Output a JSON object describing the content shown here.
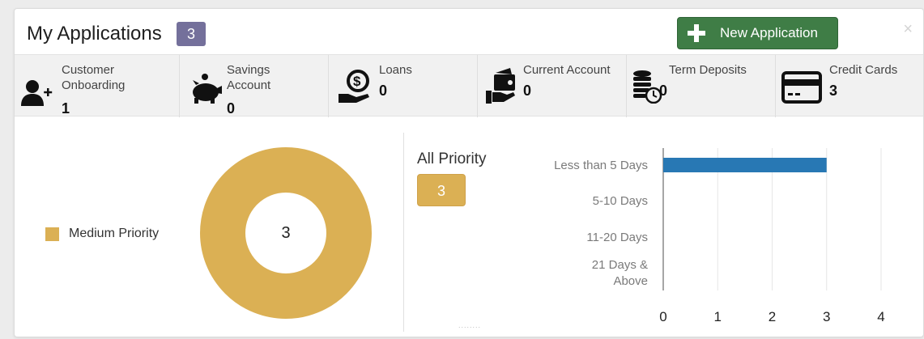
{
  "header": {
    "title": "My Applications",
    "count": "3",
    "new_application_label": "New Application",
    "close_symbol": "×"
  },
  "categories": [
    {
      "label_line1": "Customer",
      "label_line2": "Onboarding",
      "value": "1",
      "icon": "add-user-icon"
    },
    {
      "label_line1": "Savings",
      "label_line2": "Account",
      "value": "0",
      "icon": "piggy-bank-icon"
    },
    {
      "label_line1": "Loans",
      "label_line2": "",
      "value": "0",
      "icon": "loan-hand-coin-icon"
    },
    {
      "label_line1": "Current Account",
      "label_line2": "",
      "value": "0",
      "icon": "wallet-hand-icon"
    },
    {
      "label_line1": "Term Deposits",
      "label_line2": "",
      "value": "0",
      "icon": "coins-clock-icon"
    },
    {
      "label_line1": "Credit Cards",
      "label_line2": "",
      "value": "3",
      "icon": "credit-card-icon"
    }
  ],
  "donut": {
    "legend": "Medium Priority",
    "center_value": "3",
    "color": "#dbb054"
  },
  "priority": {
    "title": "All Priority",
    "count": "3"
  },
  "chart_data": {
    "type": "bar",
    "orientation": "horizontal",
    "categories": [
      "Less than 5 Days",
      "5-10 Days",
      "11-20 Days",
      "21 Days & Above"
    ],
    "values": [
      3,
      0,
      0,
      0
    ],
    "xlim": [
      0,
      4
    ],
    "xticks": [
      "0",
      "1",
      "2",
      "3",
      "4"
    ],
    "grid": true,
    "bar_color": "#2878b4"
  },
  "colors": {
    "accent_green": "#3f7d46",
    "badge_purple": "#74709b",
    "priority_gold": "#dbb054",
    "bar_blue": "#2878b4"
  }
}
